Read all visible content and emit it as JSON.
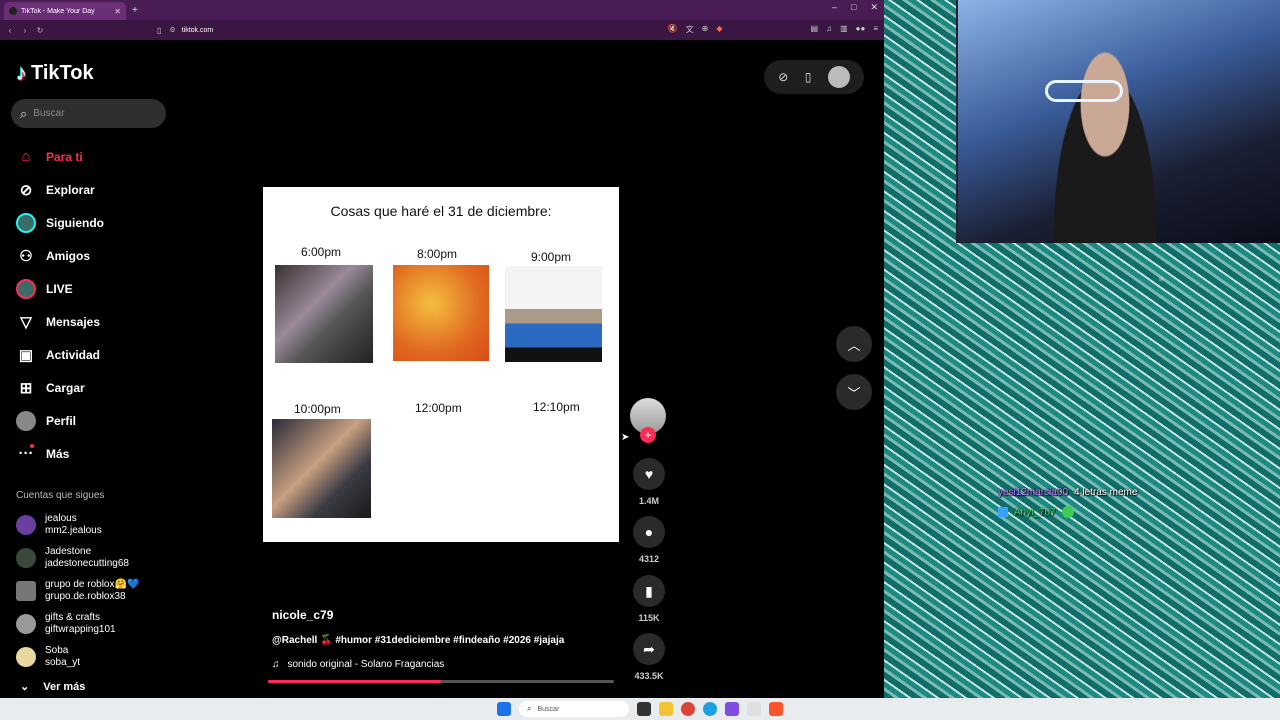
{
  "browser": {
    "tab_title": "TikTok - Make Your Day",
    "tab_close": "✕",
    "new_tab": "+",
    "url": "tiktok.com",
    "window_controls": [
      "–",
      "□",
      "✕"
    ]
  },
  "sidebar": {
    "logo_text": "TikTok",
    "search_placeholder": "Buscar",
    "items": [
      {
        "label": "Para ti",
        "icon": "home-icon"
      },
      {
        "label": "Explorar",
        "icon": "compass-icon"
      },
      {
        "label": "Siguiendo",
        "icon": "following-avatar"
      },
      {
        "label": "Amigos",
        "icon": "friends-icon"
      },
      {
        "label": "LIVE",
        "icon": "live-avatar"
      },
      {
        "label": "Mensajes",
        "icon": "messages-icon"
      },
      {
        "label": "Actividad",
        "icon": "activity-icon"
      },
      {
        "label": "Cargar",
        "icon": "upload-icon"
      },
      {
        "label": "Perfil",
        "icon": "profile-avatar"
      },
      {
        "label": "Más",
        "icon": "more-icon"
      }
    ],
    "following_title": "Cuentas que sigues",
    "following": [
      {
        "name": "jealous",
        "user": "mm2.jealous"
      },
      {
        "name": "Jadestone",
        "user": "jadestonecutting68"
      },
      {
        "name": "grupo de roblox🤗💙",
        "user": "grupo.de.roblox38"
      },
      {
        "name": "gifts & crafts",
        "user": "giftwrapping101"
      },
      {
        "name": "Soba",
        "user": "soba_yt"
      }
    ],
    "see_more": "Ver más"
  },
  "video": {
    "title": "Cosas que haré el 31 de diciembre:",
    "times": [
      "6:00pm",
      "8:00pm",
      "9:00pm",
      "10:00pm",
      "12:00pm",
      "12:10pm"
    ],
    "author": "nicole_c79",
    "description": "@Rachell 🍒 #humor #31dediciembre #findeaño #2026 #jajaja",
    "sound": "sonido original - Solano Fragancias",
    "progress": 0.5
  },
  "actions": {
    "likes": "1.4M",
    "comments": "4312",
    "saves": "115K",
    "shares": "433.5K"
  },
  "chat": [
    {
      "user": "yesi12marcia00",
      "text": "4 letras meme"
    },
    {
      "user": "Anyi_7u7",
      "text": ""
    }
  ],
  "taskbar": {
    "search_placeholder": "Buscar"
  },
  "colors": {
    "accent": "#fe2c55",
    "tab_bar": "#4a1c55",
    "address_bar": "#3a1743"
  }
}
